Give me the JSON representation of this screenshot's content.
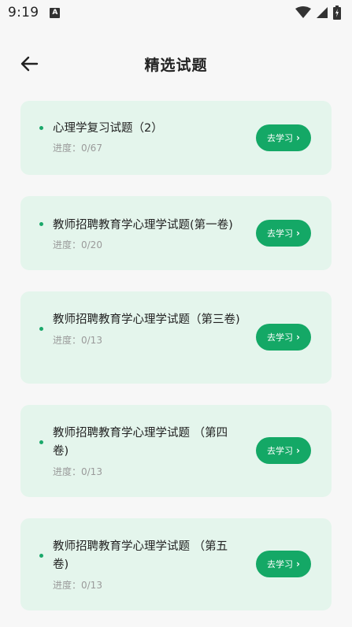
{
  "status": {
    "time": "9:19",
    "notification_icon": "A"
  },
  "header": {
    "title": "精选试题"
  },
  "items": [
    {
      "title": "心理学复习试题（2）",
      "progress": "进度：0/67",
      "button": "去学习"
    },
    {
      "title": "教师招聘教育学心理学试题(第一卷)",
      "progress": "进度：0/20",
      "button": "去学习"
    },
    {
      "title": "教师招聘教育学心理学试题（第三卷)",
      "progress": "进度：0/13",
      "button": "去学习"
    },
    {
      "title": "教师招聘教育学心理学试题 （第四卷)",
      "progress": "进度：0/13",
      "button": "去学习"
    },
    {
      "title": "教师招聘教育学心理学试题 （第五卷)",
      "progress": "进度：0/13",
      "button": "去学习"
    }
  ],
  "colors": {
    "accent": "#14a866",
    "card_bg": "#e4f5ec"
  }
}
